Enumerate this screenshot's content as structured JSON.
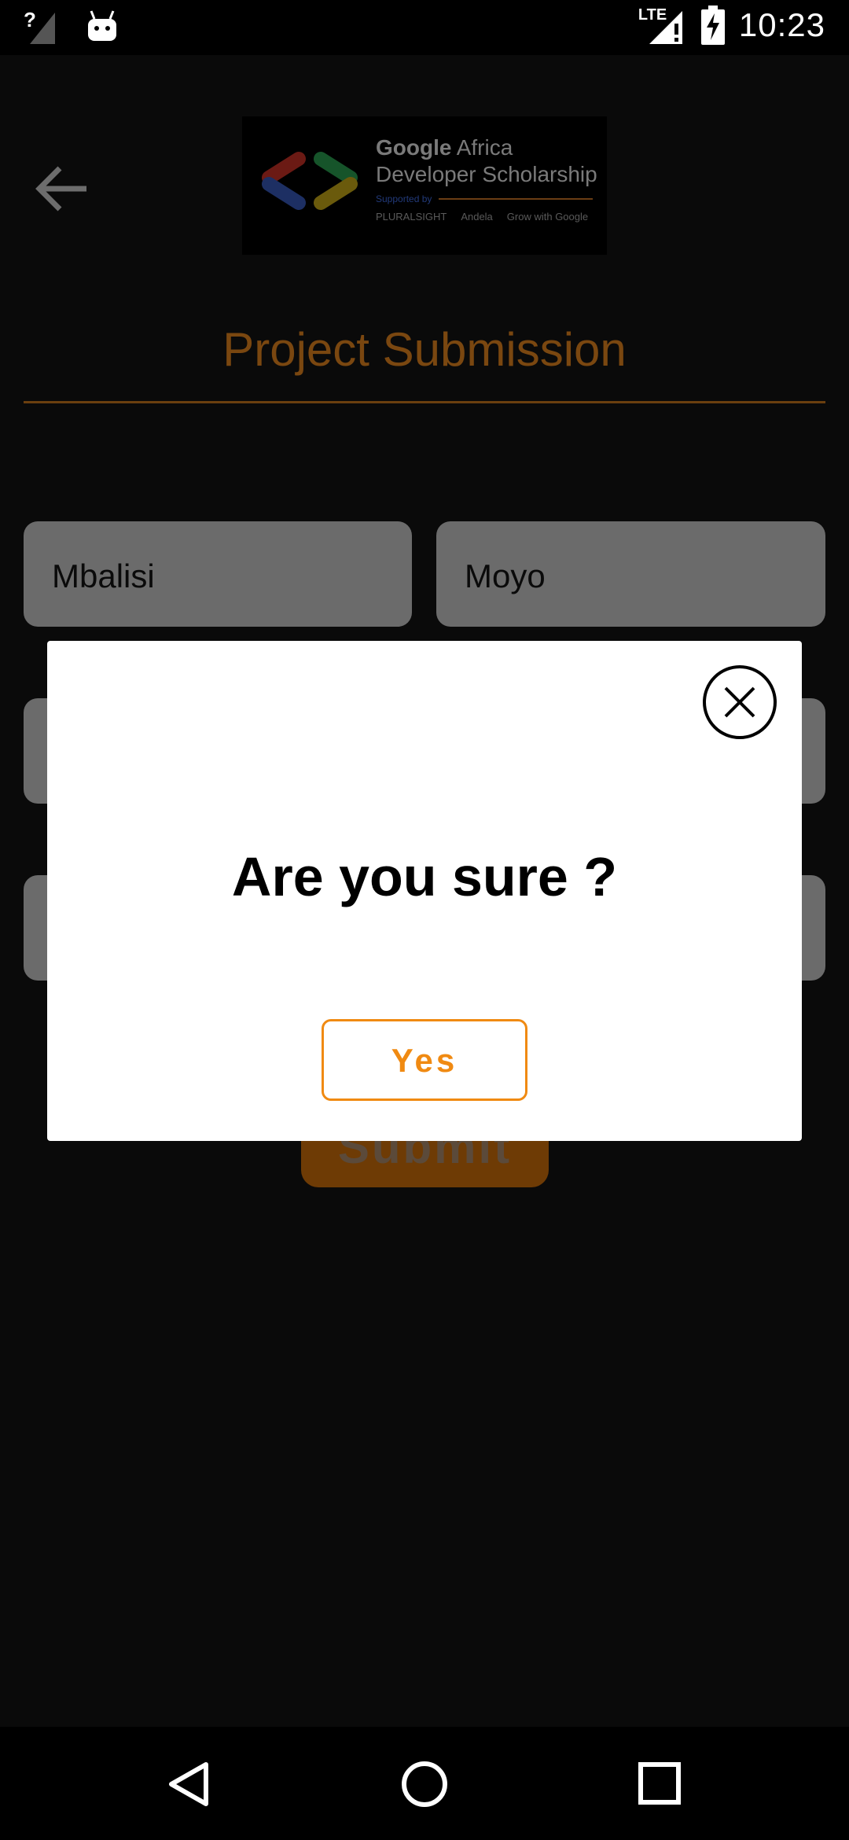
{
  "status_bar": {
    "time": "10:23",
    "network_type": "LTE",
    "icons": [
      "signal-unknown-icon",
      "android-icon",
      "signal-lte-icon",
      "battery-charging-icon"
    ]
  },
  "header": {
    "back_icon": "arrow-back-icon",
    "banner": {
      "line1_bold": "Google",
      "line1_rest": " Africa",
      "line2": "Developer Scholarship",
      "supported_by": "Supported by",
      "partners": [
        "PLURALSIGHT",
        "Andela",
        "Grow with Google"
      ]
    },
    "page_title": "Project Submission"
  },
  "form": {
    "first_name": "Mbalisi",
    "last_name": "Moyo",
    "submit_label": "Submit"
  },
  "dialog": {
    "message": "Are you sure ?",
    "confirm_label": "Yes",
    "close_icon": "close-circle-icon"
  },
  "nav_bar": {
    "icons": [
      "nav-back-icon",
      "nav-home-icon",
      "nav-recents-icon"
    ]
  },
  "colors": {
    "accent": "#f08a12",
    "dim_accent": "#6e3b05",
    "background": "#0a0a0a"
  }
}
